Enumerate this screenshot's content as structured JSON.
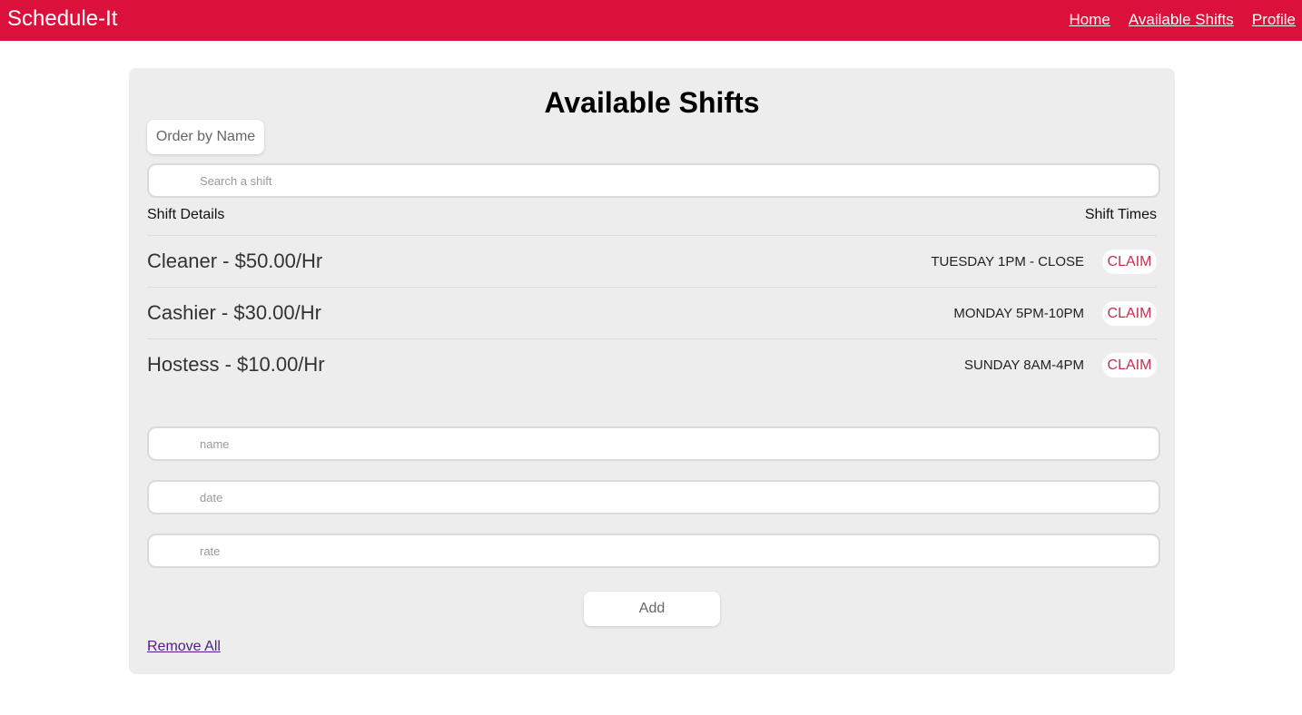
{
  "app": {
    "brand": "Schedule-It"
  },
  "nav": {
    "items": [
      {
        "label": "Home"
      },
      {
        "label": "Available Shifts"
      },
      {
        "label": "Profile"
      }
    ]
  },
  "main": {
    "title": "Available Shifts",
    "order_button": "Order by Name",
    "search": {
      "placeholder": "Search a shift",
      "value": ""
    },
    "columns": {
      "left": "Shift Details",
      "right": "Shift Times"
    },
    "shifts": [
      {
        "detail": "Cleaner - $50.00/Hr",
        "time": "TUESDAY 1PM - CLOSE",
        "action": "CLAIM"
      },
      {
        "detail": "Cashier - $30.00/Hr",
        "time": "MONDAY 5PM-10PM",
        "action": "CLAIM"
      },
      {
        "detail": "Hostess - $10.00/Hr",
        "time": "SUNDAY 8AM-4PM",
        "action": "CLAIM"
      }
    ],
    "form": {
      "name": {
        "placeholder": "name",
        "value": ""
      },
      "date": {
        "placeholder": "date",
        "value": ""
      },
      "rate": {
        "placeholder": "rate",
        "value": ""
      },
      "add_button": "Add"
    },
    "remove_all": "Remove All"
  },
  "colors": {
    "header_bg": "#dc113b",
    "panel_bg": "#ededed",
    "claim_text": "#c4314f",
    "visited_link": "#551a8b"
  }
}
